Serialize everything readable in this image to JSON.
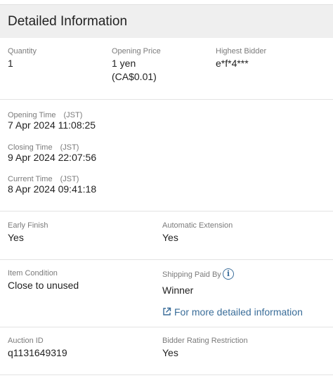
{
  "header": {
    "title": "Detailed Information"
  },
  "summary": {
    "quantity_label": "Quantity",
    "quantity_value": "1",
    "opening_price_label": "Opening Price",
    "opening_price_value": "1 yen",
    "opening_price_converted": "(CA$0.01)",
    "highest_bidder_label": "Highest Bidder",
    "highest_bidder_value": "e*f*4***"
  },
  "times": {
    "opening_label": "Opening Time　(JST)",
    "opening_value": "7 Apr 2024 11:08:25",
    "closing_label": "Closing Time　(JST)",
    "closing_value": "9 Apr 2024 22:07:56",
    "current_label": "Current Time　(JST)",
    "current_value": "8 Apr 2024 09:41:18"
  },
  "finish": {
    "early_finish_label": "Early Finish",
    "early_finish_value": "Yes",
    "auto_extension_label": "Automatic Extension",
    "auto_extension_value": "Yes"
  },
  "condition": {
    "item_condition_label": "Item Condition",
    "item_condition_value": "Close to unused",
    "shipping_label": "Shipping Paid By",
    "shipping_value": "Winner",
    "more_info_link": "For more detailed information",
    "info_icon": "info-icon",
    "external_link_icon": "external-link-icon"
  },
  "auction": {
    "auction_id_label": "Auction ID",
    "auction_id_value": "q1131649319",
    "rating_restriction_label": "Bidder Rating Restriction",
    "rating_restriction_value": "Yes"
  },
  "colors": {
    "header_bg": "#efefef",
    "label": "#7b7b7b",
    "link": "#3a6d99"
  }
}
